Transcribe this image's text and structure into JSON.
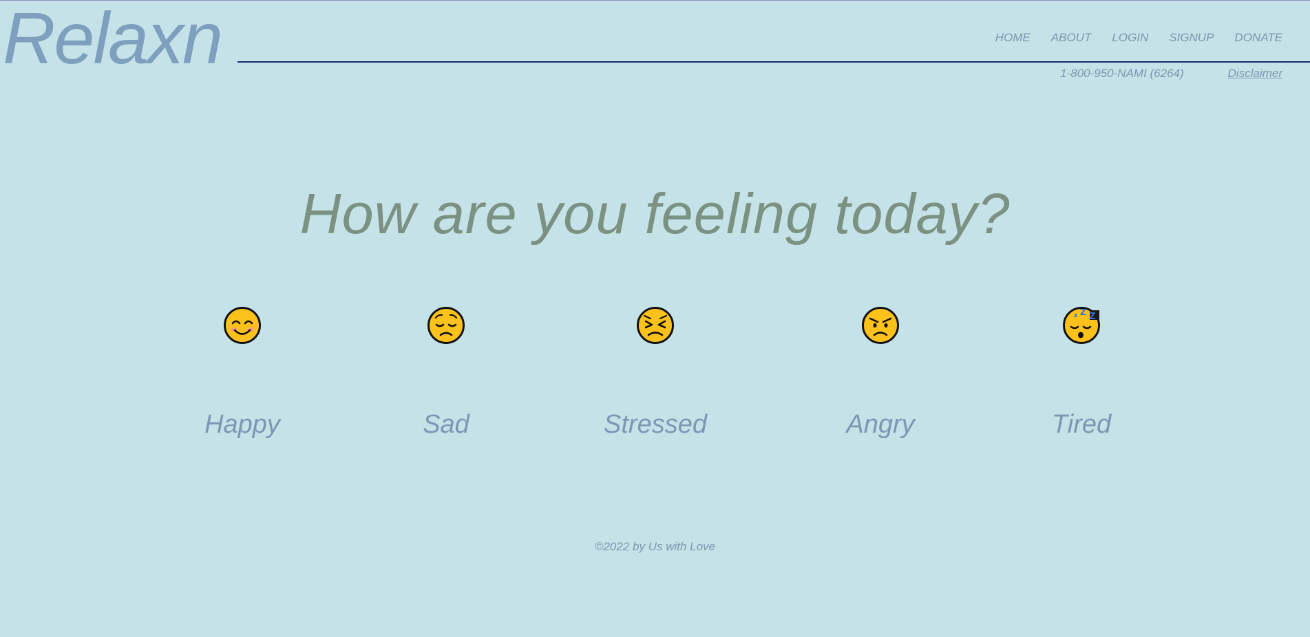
{
  "brand": {
    "name": "Relaxn"
  },
  "nav": {
    "items": [
      {
        "label": "HOME"
      },
      {
        "label": "ABOUT"
      },
      {
        "label": "LOGIN"
      },
      {
        "label": "SIGNUP"
      },
      {
        "label": "DONATE"
      }
    ],
    "phone": "1-800-950-NAMI (6264)",
    "disclaimer": "Disclaimer"
  },
  "main": {
    "headline": "How are you feeling today?",
    "moods": [
      {
        "label": "Happy",
        "icon": "smiling-face-icon"
      },
      {
        "label": "Sad",
        "icon": "pensive-face-icon"
      },
      {
        "label": "Stressed",
        "icon": "persevering-face-icon"
      },
      {
        "label": "Angry",
        "icon": "angry-face-icon"
      },
      {
        "label": "Tired",
        "icon": "sleeping-face-icon"
      }
    ]
  },
  "footer": {
    "text": "©2022 by Us with Love"
  },
  "colors": {
    "background": "#c5e2e8",
    "logo": "#7e9fbd",
    "headline": "#7b9182",
    "rule": "#1c2a6b",
    "emoji_fill": "#fcc21b"
  }
}
